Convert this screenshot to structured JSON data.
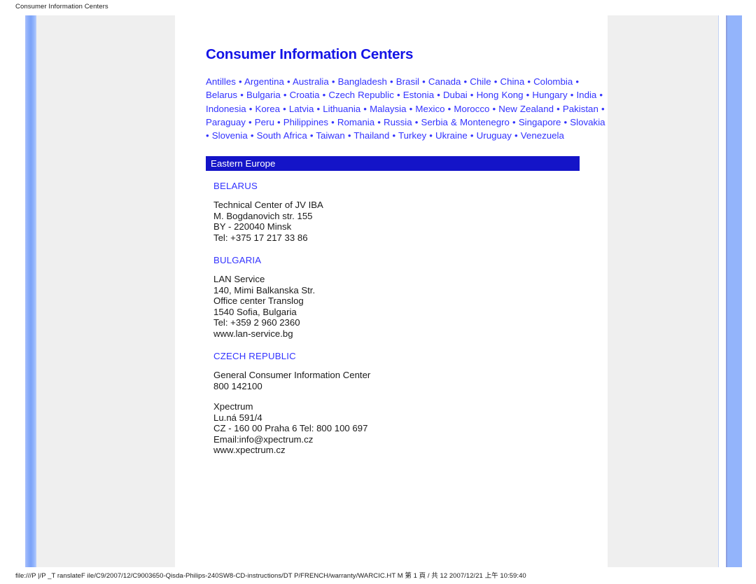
{
  "browser_chrome": {
    "header_title": "Consumer Information Centers",
    "footer_url": "file:///P |/P _T ranslateF ile/C9/2007/12/C9003650-Qisda-Philips-240SW8-CD-instructions/DT P/FRENCH/warranty/WARCIC.HT M 第 1 頁 / 共 12 2007/12/21 上午 10:59:40"
  },
  "document": {
    "title": "Consumer Information Centers",
    "country_links": [
      [
        "Antilles",
        "Argentina",
        "Australia",
        "Bangladesh",
        "Brasil",
        "Canada",
        "Chile",
        "China",
        "Colombia"
      ],
      [
        "Belarus",
        "Bulgaria",
        "Croatia",
        "Czech Republic",
        "Estonia",
        "Dubai",
        " Hong Kong",
        "Hungary"
      ],
      [
        "India",
        "Indonesia",
        "Korea",
        "Latvia",
        "Lithuania",
        "Malaysia",
        "Mexico",
        "Morocco",
        "New Zealand"
      ],
      [
        "Pakistan",
        "Paraguay",
        "Peru",
        "Philippines ",
        "Romania",
        "Russia",
        "Serbia & Montenegro"
      ],
      [
        "Singapore",
        "Slovakia",
        "Slovenia",
        "South Africa",
        "Taiwan",
        "Thailand",
        "Turkey",
        "Ukraine"
      ],
      [
        "Uruguay",
        "Venezuela"
      ]
    ],
    "separator": "•",
    "section_header": "Eastern Europe",
    "entries": [
      {
        "country": "BELARUS",
        "lines": [
          "Technical Center of JV IBA",
          "M. Bogdanovich str. 155",
          "BY - 220040 Minsk",
          "Tel: +375 17 217 33 86"
        ]
      },
      {
        "country": "BULGARIA",
        "lines": [
          "LAN Service",
          "140, Mimi Balkanska Str.",
          "Office center Translog",
          "1540 Sofia, Bulgaria",
          "Tel: +359 2 960 2360",
          "www.lan-service.bg"
        ]
      },
      {
        "country": "CZECH REPUBLIC",
        "lines": [
          "General Consumer Information Center",
          "800 142100",
          "",
          "Xpectrum",
          "Lu.ná 591/4",
          "CZ - 160 00 Praha 6 Tel: 800 100 697",
          "Email:info@xpectrum.cz",
          "www.xpectrum.cz"
        ]
      }
    ]
  },
  "colors": {
    "title_blue": "#1414e6",
    "link_blue": "#3333ff",
    "section_bar_bg": "#1414c8",
    "section_bar_text": "#ffffff",
    "body_text": "#1a1a1a",
    "page_grey": "#efefef",
    "accent_blue": "#93b4fb"
  }
}
